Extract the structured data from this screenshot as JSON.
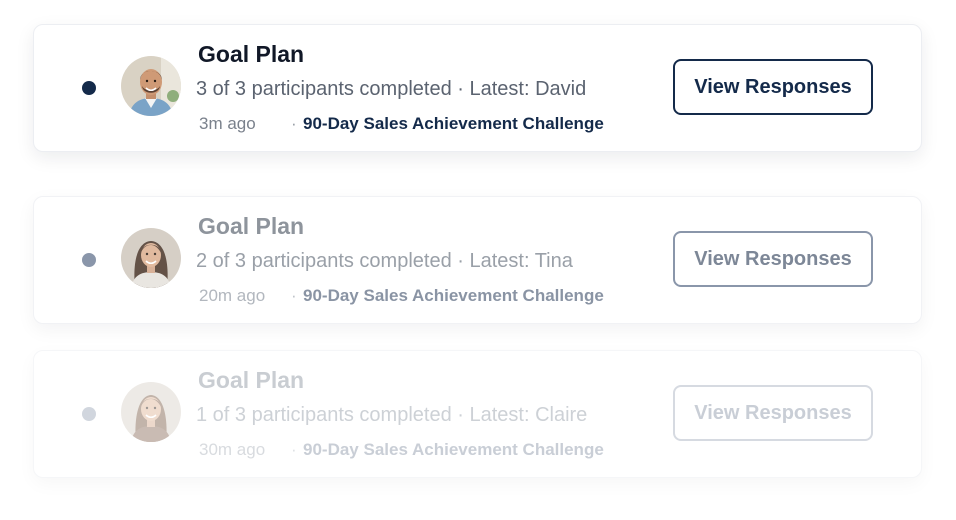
{
  "cards": [
    {
      "title": "Goal Plan",
      "summary": "3 of 3 participants completed · Latest: David",
      "time": "3m ago",
      "separator": "·",
      "challenge": "90-Day Sales Achievement Challenge",
      "button_label": "View Responses",
      "avatar": "man-avatar"
    },
    {
      "title": "Goal Plan",
      "summary": "2 of 3 participants completed · Latest: Tina",
      "time": "20m ago",
      "separator": "·",
      "challenge": "90-Day Sales Achievement Challenge",
      "button_label": "View Responses",
      "avatar": "woman-avatar"
    },
    {
      "title": "Goal Plan",
      "summary": "1 of 3 participants completed · Latest: Claire",
      "time": "30m ago",
      "separator": "·",
      "challenge": "90-Day Sales Achievement Challenge",
      "button_label": "View Responses",
      "avatar": "woman-avatar"
    }
  ],
  "colors": {
    "accent": "#142a4a",
    "muted_accent": "#8a96aa",
    "faded_accent": "#d1d6de"
  }
}
